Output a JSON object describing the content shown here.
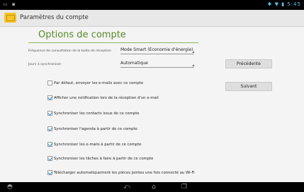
{
  "status_bar": {
    "left_icons": "▭ ▪",
    "right_icons": "✱ ▼ ▮ 5:45"
  },
  "action_bar": {
    "title": "Paramètres du compte",
    "icon": "email-app-icon"
  },
  "page": {
    "title": "Options de compte"
  },
  "fields": {
    "frequency": {
      "label": "Fréquence de consultation de la boîte de réception",
      "value": "Mode Smart (Economie d'énergie)"
    },
    "sync_days": {
      "label": "Jours à synchroniser",
      "value": "Automatique"
    }
  },
  "buttons": {
    "previous": "Précédente",
    "next": "Suivant"
  },
  "options": [
    {
      "label": "Par défaut, envoyer les e-mails avec ce compte",
      "checked": false
    },
    {
      "label": "Afficher une notification lors de la réception d'un e-mail",
      "checked": true
    },
    {
      "label": "Synchroniser les contacts issus de ce compte",
      "checked": true
    },
    {
      "label": "Synchroniser l'agenda à partir de ce compte",
      "checked": true
    },
    {
      "label": "Synchroniser les e-mails à partir de ce compte",
      "checked": true
    },
    {
      "label": "Synchroniser les tâches à faire à partir de ce compte",
      "checked": true
    },
    {
      "label": "Télécharger automatiquement les pièces jointes une fois connecté au Wi-Fi",
      "checked": true
    }
  ],
  "nav_bar": {
    "icons": [
      "asus-logo-icon",
      "back-icon",
      "home-icon",
      "recent-apps-icon"
    ]
  },
  "colors": {
    "accent": "#5a8a28",
    "checkbox": "#2b8fd8"
  }
}
